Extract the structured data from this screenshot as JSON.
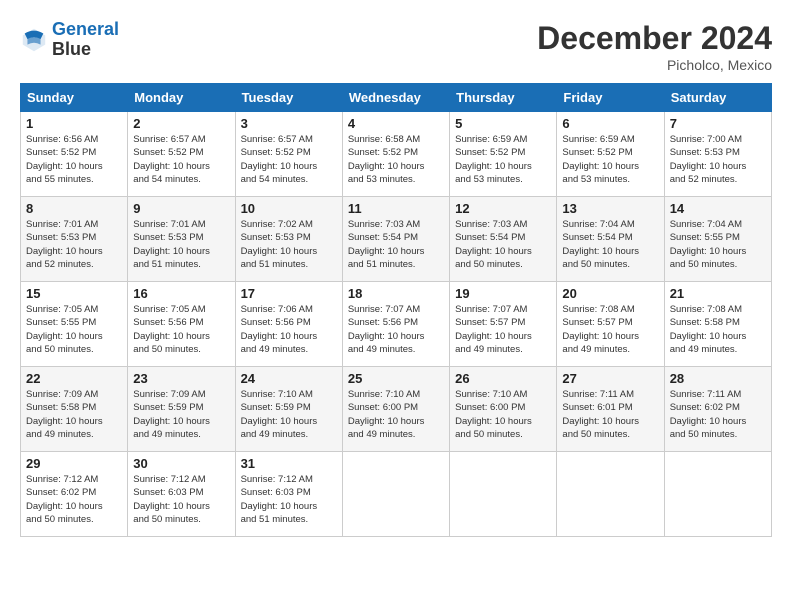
{
  "header": {
    "logo_line1": "General",
    "logo_line2": "Blue",
    "month": "December 2024",
    "location": "Picholco, Mexico"
  },
  "weekdays": [
    "Sunday",
    "Monday",
    "Tuesday",
    "Wednesday",
    "Thursday",
    "Friday",
    "Saturday"
  ],
  "weeks": [
    [
      {
        "day": "1",
        "info": "Sunrise: 6:56 AM\nSunset: 5:52 PM\nDaylight: 10 hours\nand 55 minutes."
      },
      {
        "day": "2",
        "info": "Sunrise: 6:57 AM\nSunset: 5:52 PM\nDaylight: 10 hours\nand 54 minutes."
      },
      {
        "day": "3",
        "info": "Sunrise: 6:57 AM\nSunset: 5:52 PM\nDaylight: 10 hours\nand 54 minutes."
      },
      {
        "day": "4",
        "info": "Sunrise: 6:58 AM\nSunset: 5:52 PM\nDaylight: 10 hours\nand 53 minutes."
      },
      {
        "day": "5",
        "info": "Sunrise: 6:59 AM\nSunset: 5:52 PM\nDaylight: 10 hours\nand 53 minutes."
      },
      {
        "day": "6",
        "info": "Sunrise: 6:59 AM\nSunset: 5:52 PM\nDaylight: 10 hours\nand 53 minutes."
      },
      {
        "day": "7",
        "info": "Sunrise: 7:00 AM\nSunset: 5:53 PM\nDaylight: 10 hours\nand 52 minutes."
      }
    ],
    [
      {
        "day": "8",
        "info": "Sunrise: 7:01 AM\nSunset: 5:53 PM\nDaylight: 10 hours\nand 52 minutes."
      },
      {
        "day": "9",
        "info": "Sunrise: 7:01 AM\nSunset: 5:53 PM\nDaylight: 10 hours\nand 51 minutes."
      },
      {
        "day": "10",
        "info": "Sunrise: 7:02 AM\nSunset: 5:53 PM\nDaylight: 10 hours\nand 51 minutes."
      },
      {
        "day": "11",
        "info": "Sunrise: 7:03 AM\nSunset: 5:54 PM\nDaylight: 10 hours\nand 51 minutes."
      },
      {
        "day": "12",
        "info": "Sunrise: 7:03 AM\nSunset: 5:54 PM\nDaylight: 10 hours\nand 50 minutes."
      },
      {
        "day": "13",
        "info": "Sunrise: 7:04 AM\nSunset: 5:54 PM\nDaylight: 10 hours\nand 50 minutes."
      },
      {
        "day": "14",
        "info": "Sunrise: 7:04 AM\nSunset: 5:55 PM\nDaylight: 10 hours\nand 50 minutes."
      }
    ],
    [
      {
        "day": "15",
        "info": "Sunrise: 7:05 AM\nSunset: 5:55 PM\nDaylight: 10 hours\nand 50 minutes."
      },
      {
        "day": "16",
        "info": "Sunrise: 7:05 AM\nSunset: 5:56 PM\nDaylight: 10 hours\nand 50 minutes."
      },
      {
        "day": "17",
        "info": "Sunrise: 7:06 AM\nSunset: 5:56 PM\nDaylight: 10 hours\nand 49 minutes."
      },
      {
        "day": "18",
        "info": "Sunrise: 7:07 AM\nSunset: 5:56 PM\nDaylight: 10 hours\nand 49 minutes."
      },
      {
        "day": "19",
        "info": "Sunrise: 7:07 AM\nSunset: 5:57 PM\nDaylight: 10 hours\nand 49 minutes."
      },
      {
        "day": "20",
        "info": "Sunrise: 7:08 AM\nSunset: 5:57 PM\nDaylight: 10 hours\nand 49 minutes."
      },
      {
        "day": "21",
        "info": "Sunrise: 7:08 AM\nSunset: 5:58 PM\nDaylight: 10 hours\nand 49 minutes."
      }
    ],
    [
      {
        "day": "22",
        "info": "Sunrise: 7:09 AM\nSunset: 5:58 PM\nDaylight: 10 hours\nand 49 minutes."
      },
      {
        "day": "23",
        "info": "Sunrise: 7:09 AM\nSunset: 5:59 PM\nDaylight: 10 hours\nand 49 minutes."
      },
      {
        "day": "24",
        "info": "Sunrise: 7:10 AM\nSunset: 5:59 PM\nDaylight: 10 hours\nand 49 minutes."
      },
      {
        "day": "25",
        "info": "Sunrise: 7:10 AM\nSunset: 6:00 PM\nDaylight: 10 hours\nand 49 minutes."
      },
      {
        "day": "26",
        "info": "Sunrise: 7:10 AM\nSunset: 6:00 PM\nDaylight: 10 hours\nand 50 minutes."
      },
      {
        "day": "27",
        "info": "Sunrise: 7:11 AM\nSunset: 6:01 PM\nDaylight: 10 hours\nand 50 minutes."
      },
      {
        "day": "28",
        "info": "Sunrise: 7:11 AM\nSunset: 6:02 PM\nDaylight: 10 hours\nand 50 minutes."
      }
    ],
    [
      {
        "day": "29",
        "info": "Sunrise: 7:12 AM\nSunset: 6:02 PM\nDaylight: 10 hours\nand 50 minutes."
      },
      {
        "day": "30",
        "info": "Sunrise: 7:12 AM\nSunset: 6:03 PM\nDaylight: 10 hours\nand 50 minutes."
      },
      {
        "day": "31",
        "info": "Sunrise: 7:12 AM\nSunset: 6:03 PM\nDaylight: 10 hours\nand 51 minutes."
      },
      null,
      null,
      null,
      null
    ]
  ]
}
